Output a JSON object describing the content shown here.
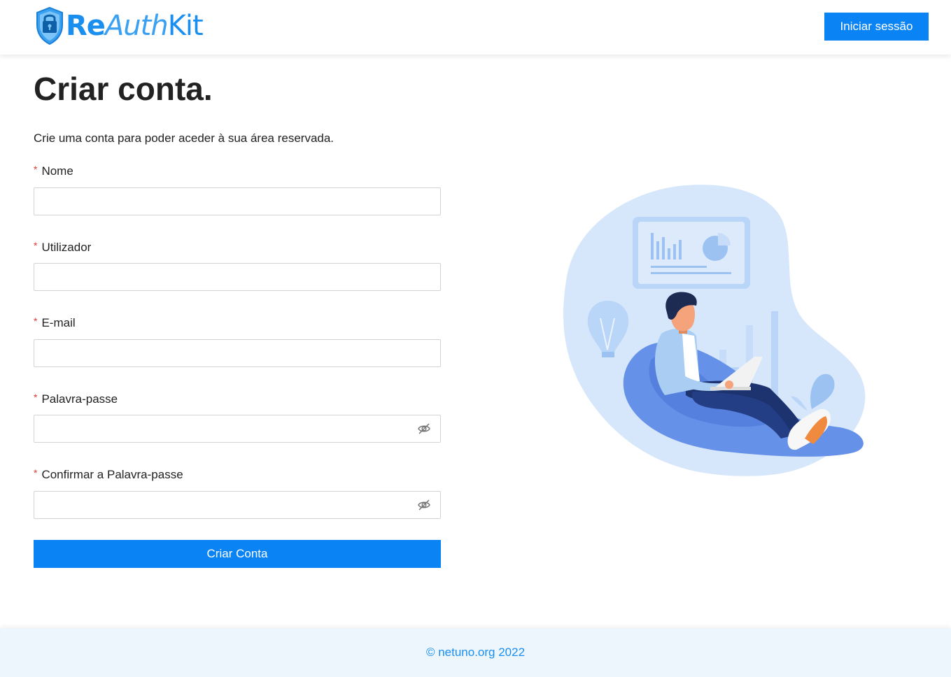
{
  "header": {
    "logo": {
      "part1": "Re",
      "part2": "Auth",
      "part3": "Kit"
    },
    "login_label": "Iniciar sessão"
  },
  "main": {
    "title": "Criar conta.",
    "subtitle": "Crie uma conta para poder aceder à sua área reservada.",
    "required_mark": "*",
    "fields": [
      {
        "label": "Nome",
        "value": "",
        "type": "text"
      },
      {
        "label": "Utilizador",
        "value": "",
        "type": "text"
      },
      {
        "label": "E-mail",
        "value": "",
        "type": "email"
      },
      {
        "label": "Palavra-passe",
        "value": "",
        "type": "password"
      },
      {
        "label": "Confirmar a Palavra-passe",
        "value": "",
        "type": "password"
      }
    ],
    "submit_label": "Criar Conta"
  },
  "footer": {
    "text": "© netuno.org 2022"
  },
  "colors": {
    "accent": "#0a84f5",
    "required": "#e53935",
    "footer_bg": "#edf6fd"
  },
  "icons": {
    "password_toggle": "eye-slash-icon",
    "logo": "padlock-shield-icon"
  }
}
